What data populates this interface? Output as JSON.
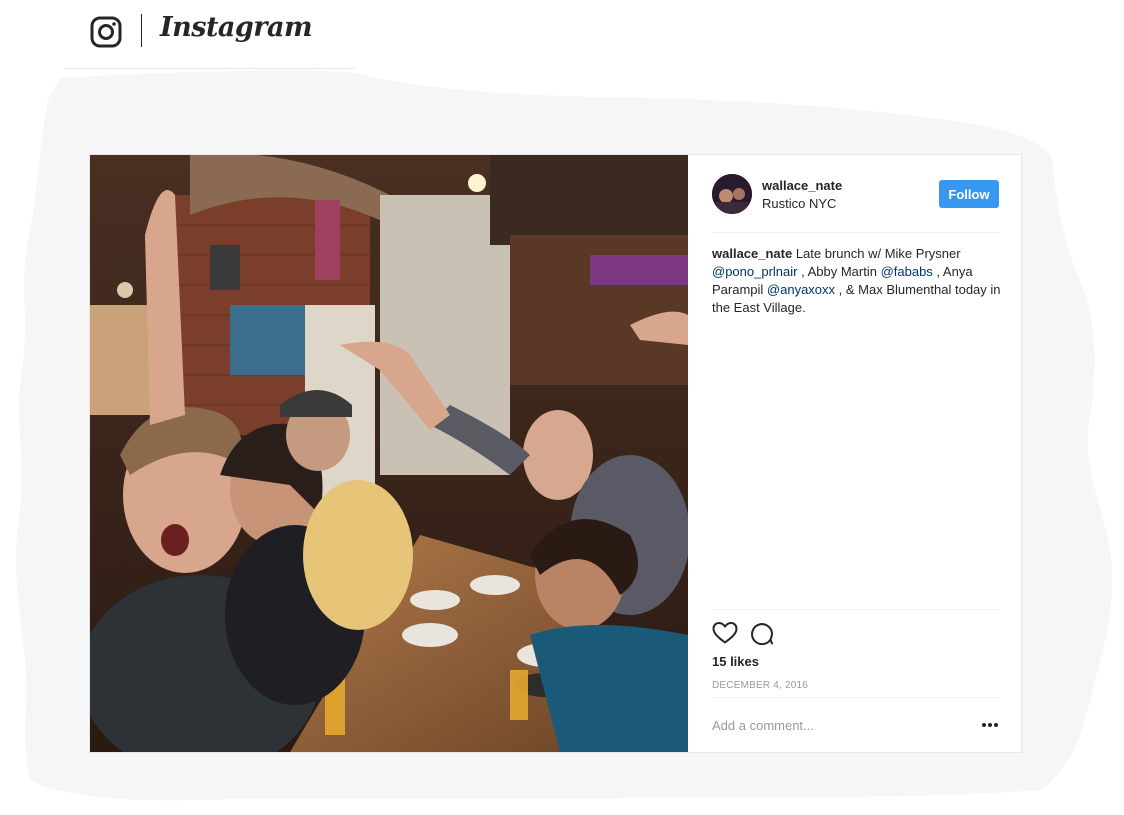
{
  "brand": {
    "wordmark": "Instagram",
    "icon": "instagram-camera-icon"
  },
  "post": {
    "author": {
      "username": "wallace_nate",
      "location": "Rustico NYC",
      "follow_label": "Follow"
    },
    "caption": {
      "username": "wallace_nate",
      "text_1": " Late brunch w/ Mike Prysner ",
      "mention_1": "@pono_prlnair",
      "text_2": " , Abby Martin ",
      "mention_2": "@fababs",
      "text_3": " , Anya Parampil ",
      "mention_3": "@anyaxoxx",
      "text_4": " , & Max Blumenthal today in the East Village."
    },
    "likes": "15 likes",
    "date": "DECEMBER 4, 2016",
    "comment_placeholder": "Add a comment...",
    "icons": {
      "like": "heart-icon",
      "comment": "comment-icon",
      "more": "more-options-icon"
    }
  },
  "colors": {
    "follow_button": "#3897f0",
    "mention": "#003569",
    "muted": "#999999",
    "text": "#262626"
  }
}
